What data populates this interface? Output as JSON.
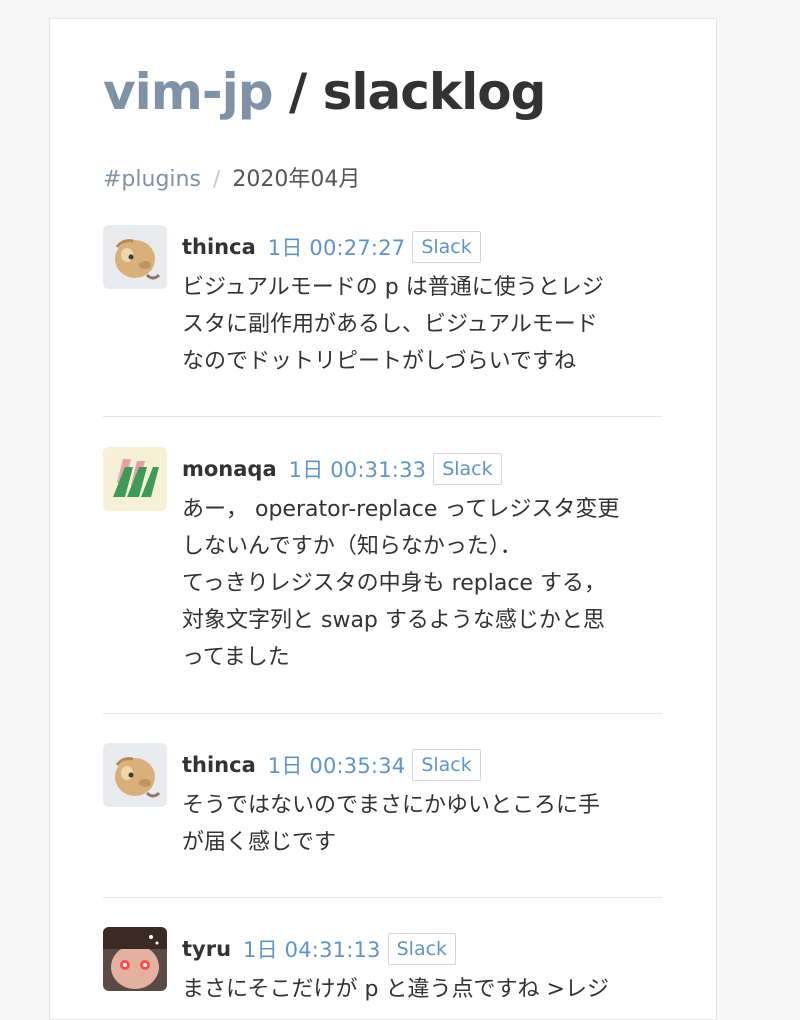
{
  "header": {
    "org": "vim-jp",
    "separator": "/",
    "repo": "slacklog"
  },
  "breadcrumb": {
    "channel": "#plugins",
    "separator": "/",
    "month": "2020年04月"
  },
  "slack_label": "Slack",
  "messages": [
    {
      "user": "thinca",
      "time": "1日 00:27:27",
      "slack": "Slack",
      "lines": [
        "ビジュアルモードの p は普通に使うとレジ",
        "スタに副作用があるし、ビジュアルモード",
        "なのでドットリピートがしづらいですね"
      ]
    },
    {
      "user": "monaqa",
      "time": "1日 00:31:33",
      "slack": "Slack",
      "lines": [
        "あー， operator-replace ってレジスタ変更",
        "しないんですか（知らなかった）．",
        "てっきりレジスタの中身も replace する，",
        "対象文字列と swap するような感じかと思",
        "ってました"
      ]
    },
    {
      "user": "thinca",
      "time": "1日 00:35:34",
      "slack": "Slack",
      "lines": [
        "そうではないのでまさにかゆいところに手",
        "が届く感じです"
      ]
    },
    {
      "user": "tyru",
      "time": "1日 04:31:13",
      "slack": "Slack",
      "lines": [
        "まさにそこだけが p と違う点ですね >レジ"
      ]
    }
  ]
}
